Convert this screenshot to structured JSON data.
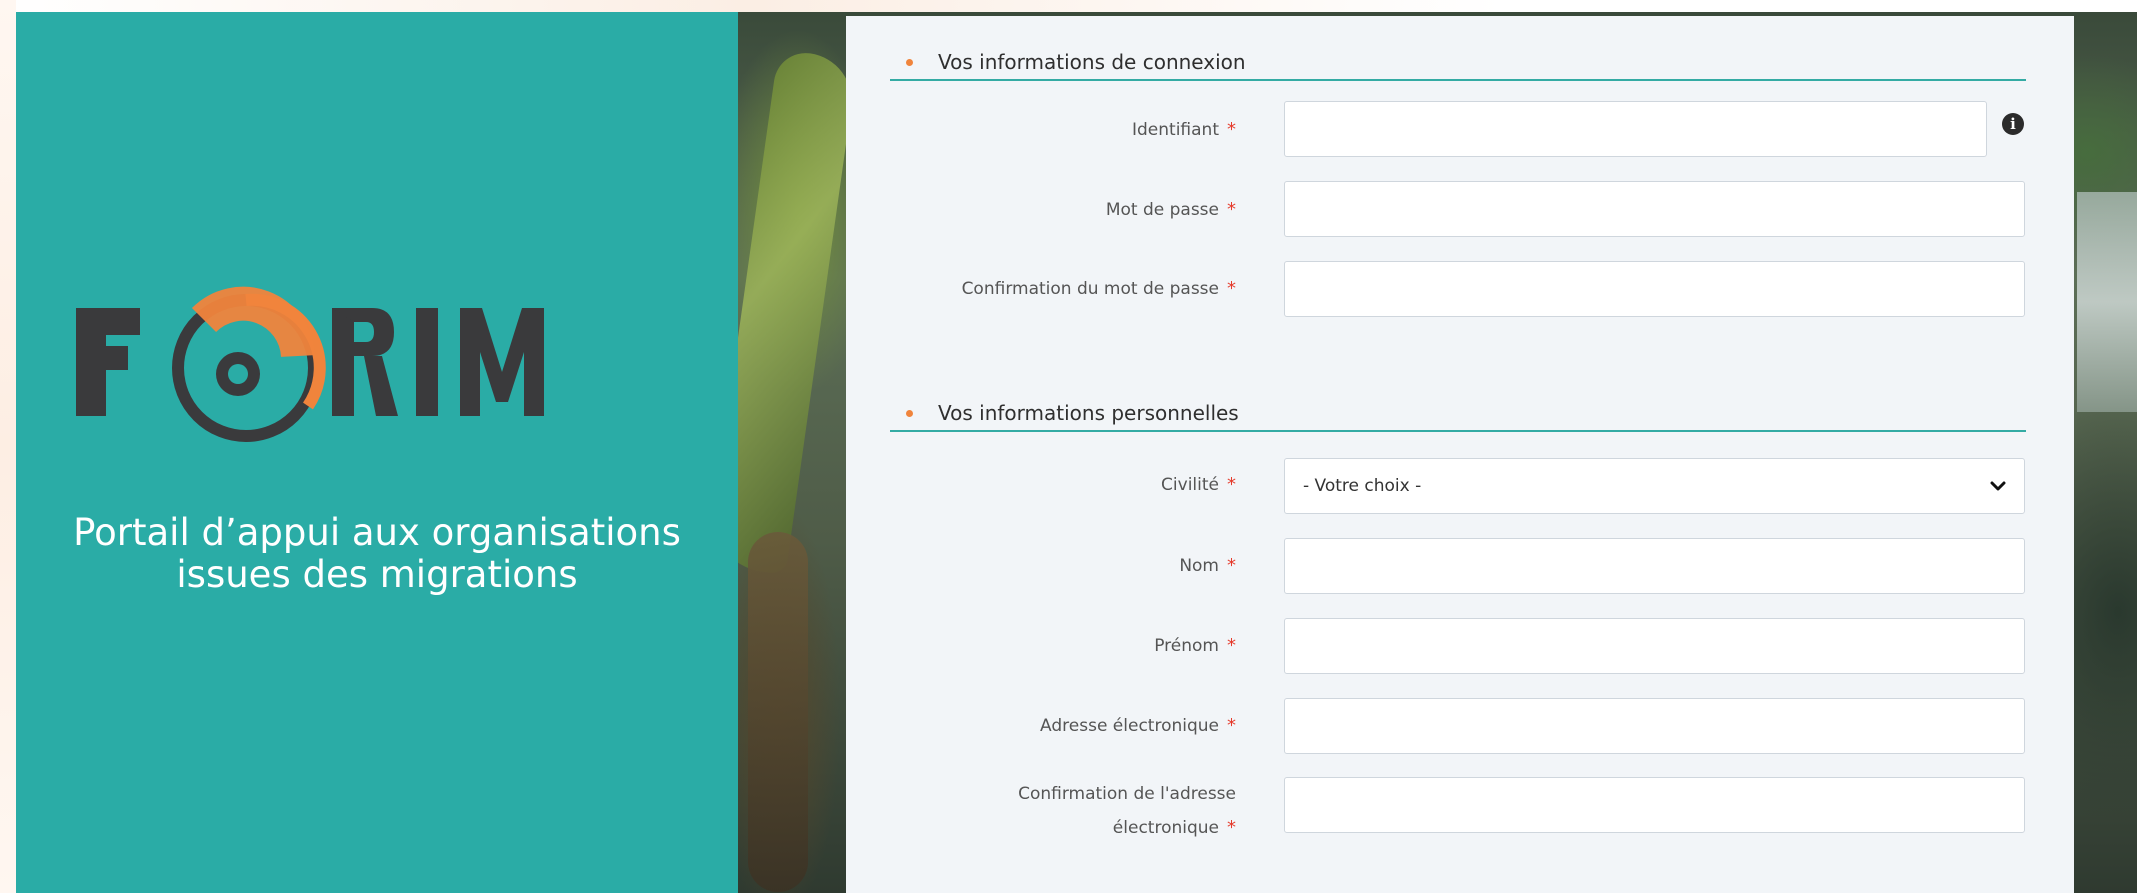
{
  "brand": {
    "logo_text": "FORIM",
    "tagline_line1": "Portail d’appui aux organisations",
    "tagline_line2": "issues des migrations",
    "colors": {
      "panel": "#2aaca6",
      "accent": "#f0843c",
      "dark": "#3a3a3c"
    }
  },
  "sections": {
    "connexion": {
      "title": "Vos informations de connexion"
    },
    "personnelles": {
      "title": "Vos informations personnelles"
    }
  },
  "required_marker": "*",
  "fields": {
    "identifiant": {
      "label": "Identifiant",
      "value": ""
    },
    "mot_de_passe": {
      "label": "Mot de passe",
      "value": ""
    },
    "confirmation_mdp": {
      "label": "Confirmation du mot de passe",
      "value": ""
    },
    "civilite": {
      "label": "Civilité",
      "selected": "- Votre choix -"
    },
    "nom": {
      "label": "Nom",
      "value": ""
    },
    "prenom": {
      "label": "Prénom",
      "value": ""
    },
    "adresse": {
      "label": "Adresse électronique",
      "value": ""
    },
    "confirmation_adresse": {
      "label_line1": "Confirmation de l'adresse",
      "label_line2": "électronique",
      "value": ""
    }
  },
  "icons": {
    "info": "info-circle-icon",
    "dropdown": "chevron-down-icon"
  }
}
